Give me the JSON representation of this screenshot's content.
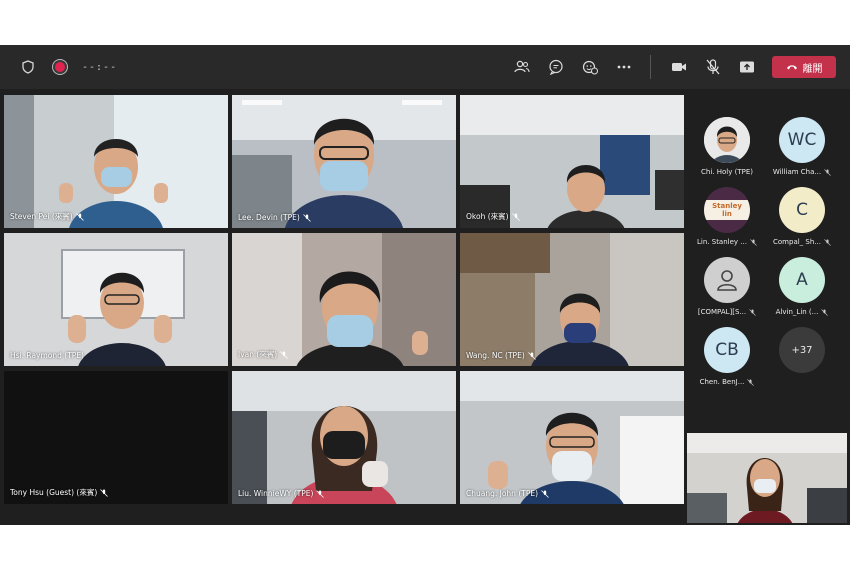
{
  "topbar": {
    "timer": "--:--",
    "icons": [
      "shield-icon",
      "record-icon"
    ],
    "right_icons": [
      "participants-icon",
      "chat-icon",
      "reactions-icon",
      "more-icon",
      "camera-icon",
      "mic-off-icon",
      "share-icon"
    ],
    "leave_label": "離開",
    "leave_color": "#c4314b"
  },
  "tiles": [
    {
      "label": "Steven Pei (來賓)"
    },
    {
      "label": "Lee. Devin (TPE)"
    },
    {
      "label": "Okoh (來賓)"
    },
    {
      "label": "Hsi. Raymond (TPE)"
    },
    {
      "label": "Ivan (來賓)"
    },
    {
      "label": "Wang. NC (TPE)"
    },
    {
      "label": "Tony Hsu (Guest) (來賓)"
    },
    {
      "label": "Liu. WinnieWY (TPE)"
    },
    {
      "label": "Chuang. John (TPE)"
    }
  ],
  "roster": [
    {
      "name": "Chi. Holy (TPE)",
      "initials": "",
      "color": "#f0f0f0"
    },
    {
      "name": "William Cha...",
      "initials": "WC",
      "color": "#cde7f3"
    },
    {
      "name": "Lin. Stanley ...",
      "initials": "Stanley lin",
      "color": "#4a2a45"
    },
    {
      "name": "Compal_ Sh...",
      "initials": "C",
      "color": "#f3ecc9"
    },
    {
      "name": "[COMPAL][S...",
      "initials": "",
      "color": "#cfcfcf"
    },
    {
      "name": "Alvin_Lin (...",
      "initials": "A",
      "color": "#c9eedd"
    },
    {
      "name": "Chen. BenJ...",
      "initials": "CB",
      "color": "#cde7f3"
    },
    {
      "name": "",
      "initials": "+37",
      "color": "#3b3b3b"
    }
  ],
  "accent": "#8e8fd8"
}
